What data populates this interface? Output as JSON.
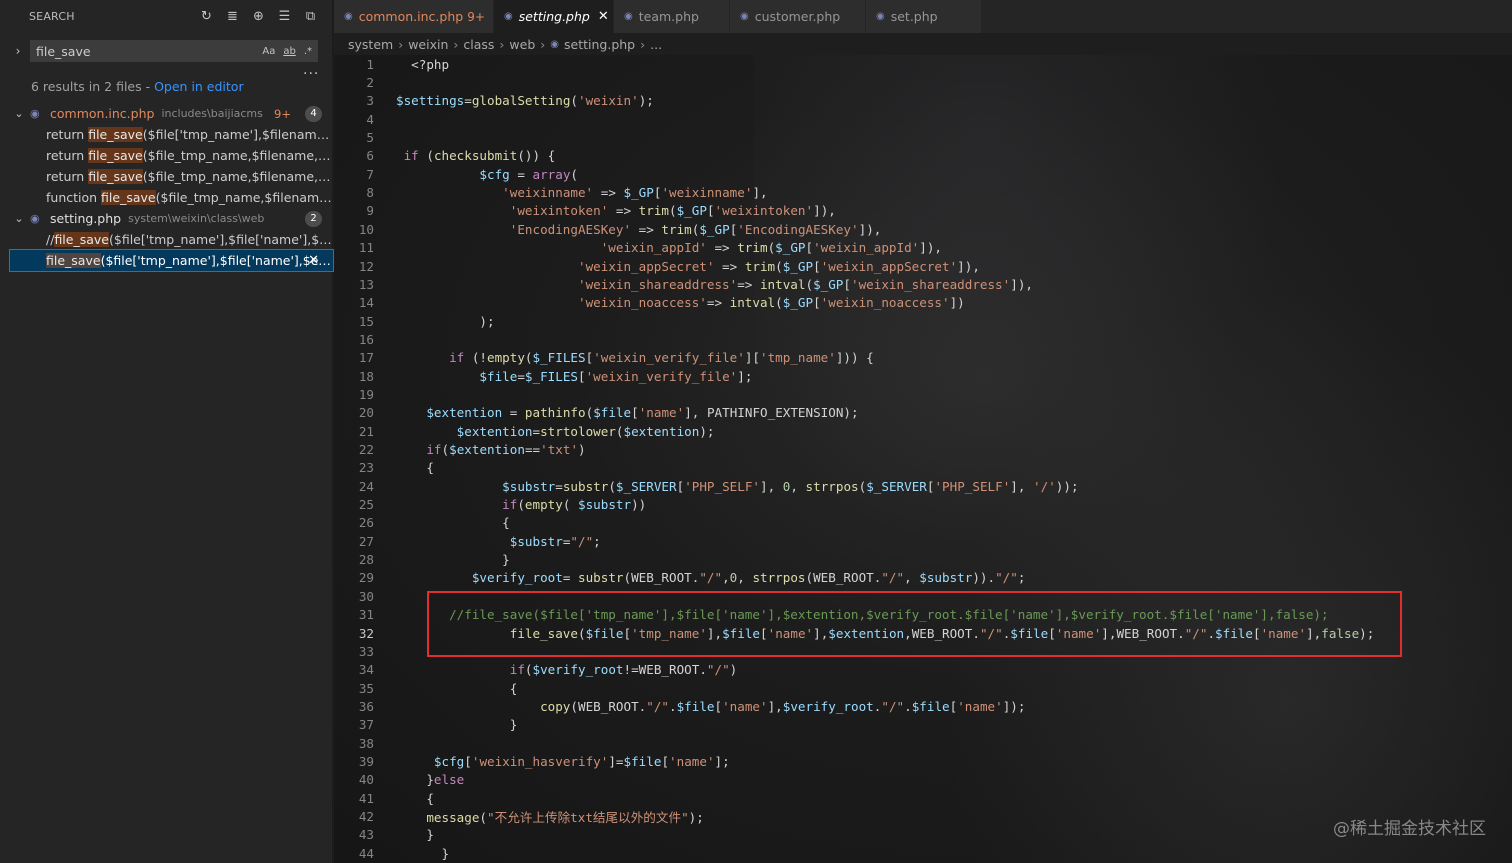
{
  "sidebar": {
    "title": "SEARCH",
    "action_icons": [
      "refresh-icon",
      "clear-results-icon",
      "new-search-editor-icon",
      "view-as-tree-icon",
      "collapse-all-icon"
    ],
    "query": "file_save",
    "options": {
      "match_case": "Aa",
      "whole_word": "ab",
      "regex": ".*"
    },
    "more": "...",
    "summary": "6 results in 2 files - ",
    "open_editor": "Open in editor",
    "files": [
      {
        "name": "common.inc.php",
        "path": "includes\\baijiacms",
        "badge": "9+",
        "count": "4",
        "matches": [
          {
            "pre": "return ",
            "hit": "file_save",
            "post": "($file['tmp_name'],$filename,$exte..."
          },
          {
            "pre": "return ",
            "hit": "file_save",
            "post": "($file_tmp_name,$filename,$extent..."
          },
          {
            "pre": "return ",
            "hit": "file_save",
            "post": "($file_tmp_name,$filename,$extent..."
          },
          {
            "pre": "function ",
            "hit": "file_save",
            "post": "($file_tmp_name,$filename,$exte..."
          }
        ]
      },
      {
        "name": "setting.php",
        "path": "system\\weixin\\class\\web",
        "count": "2",
        "matches": [
          {
            "pre": "//",
            "hit": "file_save",
            "post": "($file['tmp_name'],$file['name'],$extenti..."
          },
          {
            "pre": "",
            "hit": "file_save",
            "post": "($file['tmp_name'],$file['name'],$ex..."
          }
        ]
      }
    ]
  },
  "tabs": [
    {
      "label": "common.inc.php",
      "badge": "9+"
    },
    {
      "label": "setting.php"
    },
    {
      "label": "team.php"
    },
    {
      "label": "customer.php"
    },
    {
      "label": "set.php"
    }
  ],
  "breadcrumb": [
    "system",
    "weixin",
    "class",
    "web",
    "setting.php",
    "..."
  ],
  "code": {
    "line_numbers": [
      "1",
      "2",
      "3",
      "4",
      "5",
      "6",
      "7",
      "8",
      "9",
      "10",
      "11",
      "12",
      "13",
      "14",
      "15",
      "16",
      "17",
      "18",
      "19",
      "20",
      "21",
      "22",
      "23",
      "24",
      "25",
      "26",
      "27",
      "28",
      "29",
      "30",
      "31",
      "32",
      "33",
      "34",
      "35",
      "36",
      "37",
      "38",
      "39",
      "40",
      "41",
      "42",
      "43",
      "44"
    ],
    "lines": [
      "  <?php",
      "",
      "$settings=globalSetting('weixin');",
      "",
      "",
      " if (checksubmit()) {",
      "           $cfg = array(",
      "              'weixinname' => $_GP['weixinname'],",
      "               'weixintoken' => trim($_GP['weixintoken']),",
      "               'EncodingAESKey' => trim($_GP['EncodingAESKey']),",
      "                           'weixin_appId' => trim($_GP['weixin_appId']),",
      "                        'weixin_appSecret' => trim($_GP['weixin_appSecret']),",
      "                        'weixin_shareaddress'=> intval($_GP['weixin_shareaddress']),",
      "                        'weixin_noaccess'=> intval($_GP['weixin_noaccess'])",
      "           );",
      "",
      "       if (!empty($_FILES['weixin_verify_file']['tmp_name'])) {",
      "           $file=$_FILES['weixin_verify_file'];",
      "",
      "    $extention = pathinfo($file['name'], PATHINFO_EXTENSION);",
      "        $extention=strtolower($extention);",
      "    if($extention=='txt')",
      "    {",
      "              $substr=substr($_SERVER['PHP_SELF'], 0, strrpos($_SERVER['PHP_SELF'], '/'));",
      "              if(empty( $substr))",
      "              {",
      "               $substr=\"/\";",
      "              }",
      "          $verify_root= substr(WEB_ROOT.\"/\",0, strrpos(WEB_ROOT.\"/\", $substr)).\"/\";",
      "",
      "       //file_save($file['tmp_name'],$file['name'],$extention,$verify_root.$file['name'],$verify_root.$file['name'],false);",
      "               file_save($file['tmp_name'],$file['name'],$extention,WEB_ROOT.\"/\".$file['name'],WEB_ROOT.\"/\".$file['name'],false);",
      "",
      "               if($verify_root!=WEB_ROOT.\"/\")",
      "               {",
      "                   copy(WEB_ROOT.\"/\".$file['name'],$verify_root.\"/\".$file['name']);",
      "               }",
      "",
      "     $cfg['weixin_hasverify']=$file['name'];",
      "    }else",
      "    {",
      "    message(\"不允许上传除txt结尾以外的文件\");",
      "    }",
      "      }"
    ]
  },
  "watermark": "@稀土掘金技术社区",
  "colors": {
    "highlight_box": "#e0302e",
    "modified": "#e2875b",
    "link": "#3794ff"
  }
}
